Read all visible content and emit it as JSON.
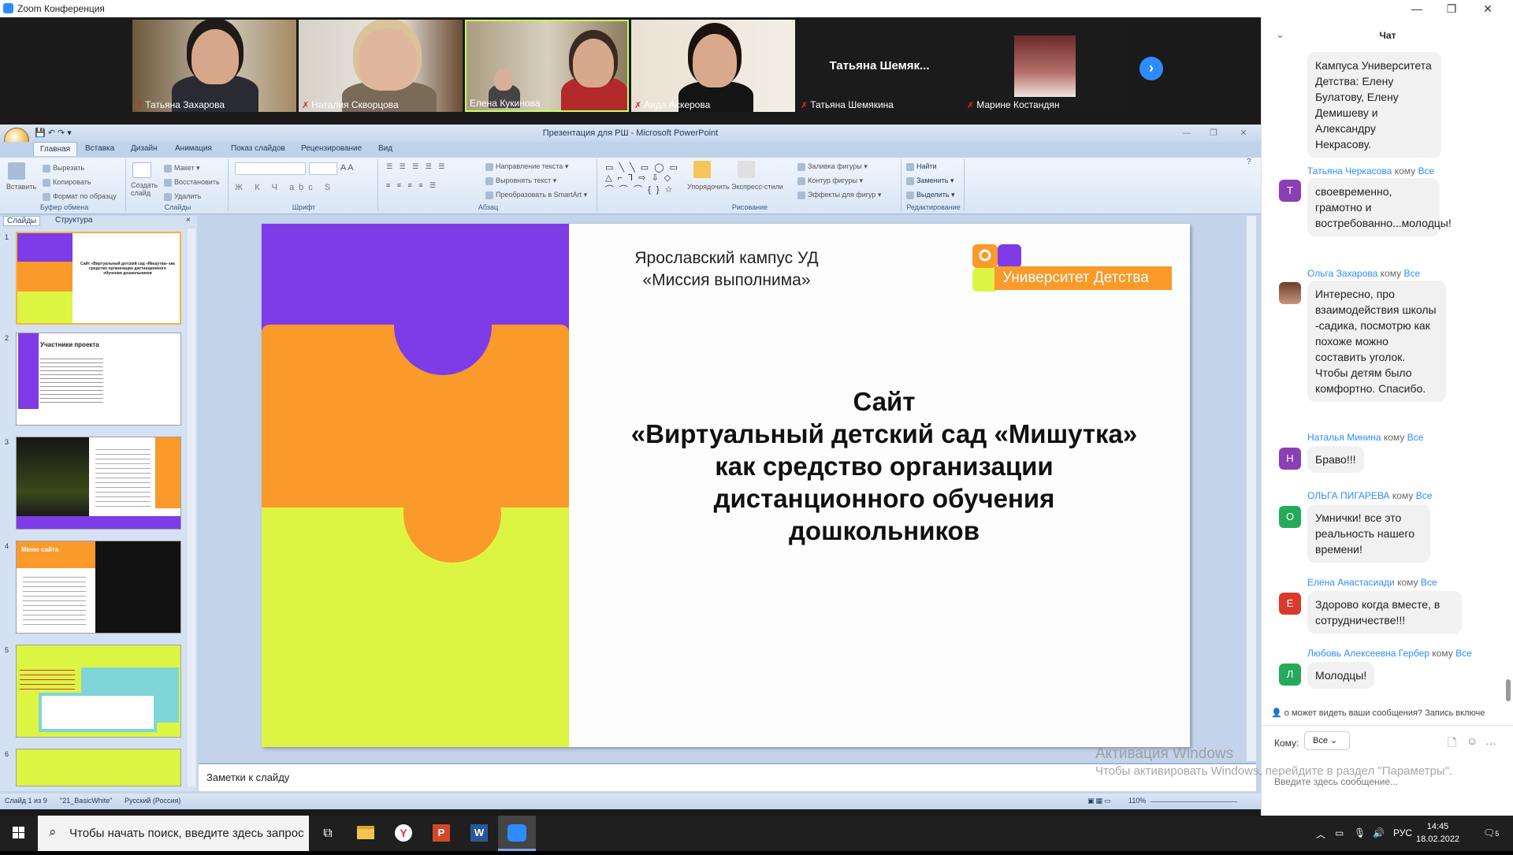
{
  "zoom": {
    "window_title": "Zoom Конференция",
    "participants": [
      {
        "name": "Татьяна Захарова"
      },
      {
        "name": "Наталия Скворцова"
      },
      {
        "name": "Елена Кукинова"
      },
      {
        "name": "Аида Аскерова"
      },
      {
        "name": "Татьяна Шемякина",
        "placeholder": "Татьяна  Шемяк..."
      },
      {
        "name": "Марине Костандян"
      }
    ]
  },
  "ppt": {
    "title": "Презентация для РШ - Microsoft PowerPoint",
    "tabs": [
      "Главная",
      "Вставка",
      "Дизайн",
      "Анимация",
      "Показ слайдов",
      "Рецензирование",
      "Вид"
    ],
    "groups": [
      "Буфер обмена",
      "Слайды",
      "Шрифт",
      "Абзац",
      "Рисование",
      "Редактирование"
    ],
    "ribbon": {
      "paste": "Вставить",
      "cut": "Вырезать",
      "copy": "Копировать",
      "format_painter": "Формат по образцу",
      "new_slide": "Создать слайд",
      "layout": "Макет",
      "reset": "Восстановить",
      "delete": "Удалить",
      "text_direction": "Направление текста",
      "align_text": "Выровнять текст",
      "smartart": "Преобразовать в SmartArt",
      "arrange": "Упорядочить",
      "quick_styles": "Экспресс-стили",
      "shape_fill": "Заливка фигуры",
      "shape_outline": "Контур фигуры",
      "shape_effects": "Эффекты для фигур",
      "find": "Найти",
      "replace": "Заменить",
      "select": "Выделить"
    },
    "pane_tabs": [
      "Слайды",
      "Структура"
    ],
    "thumb_numbers": [
      "1",
      "2",
      "3",
      "4",
      "5",
      "6"
    ],
    "thumb2_title": "Участники проекта",
    "thumb4_title": "Меню сайта",
    "slide": {
      "caption": "Ярославский кампус УД «Миссия выполнима»",
      "logo_text": "Университет Детства",
      "heading": "Сайт\n«Виртуальный детский сад «Мишутка»\nкак средство организации\nдистанционного обучения\nдошкольников"
    },
    "notes_placeholder": "Заметки к слайду",
    "status": {
      "slide_counter": "Слайд 1 из 9",
      "theme": "\"21_BasicWhite\"",
      "language": "Русский (Россия)",
      "zoom": "110%"
    }
  },
  "chat": {
    "title": "Чат",
    "to_word": "кому",
    "all_word": "Все",
    "messages": [
      {
        "sender": "",
        "text": "Кампуса Университета Детства: Елену Булатову, Елену Демишеву и Александру Некрасову."
      },
      {
        "sender": "Татьяна Черкасова",
        "initial": "Т",
        "color": "#8a3fb5",
        "text": "своевременно, грамотно и востребованно...молодцы!"
      },
      {
        "sender": "Ольга Захарова",
        "initial": "",
        "color": "#b8887a",
        "text": "Интересно, про взаимодействия школы -садика, посмотрю как похоже можно составить уголок. Чтобы детям было комфортно. Спасибо."
      },
      {
        "sender": "Наталья Минина",
        "initial": "Н",
        "color": "#8a3fb5",
        "text": "Браво!!!"
      },
      {
        "sender": "ОЛЬГА ПИГАРЕВА",
        "initial": "О",
        "color": "#26a95b",
        "text": "Умнички! все это реальность нашего времени!"
      },
      {
        "sender": "Елена Анастасиади",
        "initial": "Е",
        "color": "#d93a2b",
        "text": "Здорово когда вместе, в сотрудничестве!!!"
      },
      {
        "sender": "Любовь Алексеевна Гербер",
        "initial": "Л",
        "color": "#26a95b",
        "text": "Молодцы!"
      }
    ],
    "privacy_note": "о может видеть ваши сообщения? Запись включе",
    "to_label": "Кому:",
    "to_value": "Все",
    "input_placeholder": "Введите здесь сообщение..."
  },
  "activation": {
    "line1": "Активация Windows",
    "line2": "Чтобы активировать Windows, перейдите в раздел \"Параметры\"."
  },
  "taskbar": {
    "search_placeholder": "Чтобы начать поиск, введите здесь запрос",
    "language": "РУС",
    "time": "14:45",
    "date": "18.02.2022",
    "notifications": "5"
  }
}
